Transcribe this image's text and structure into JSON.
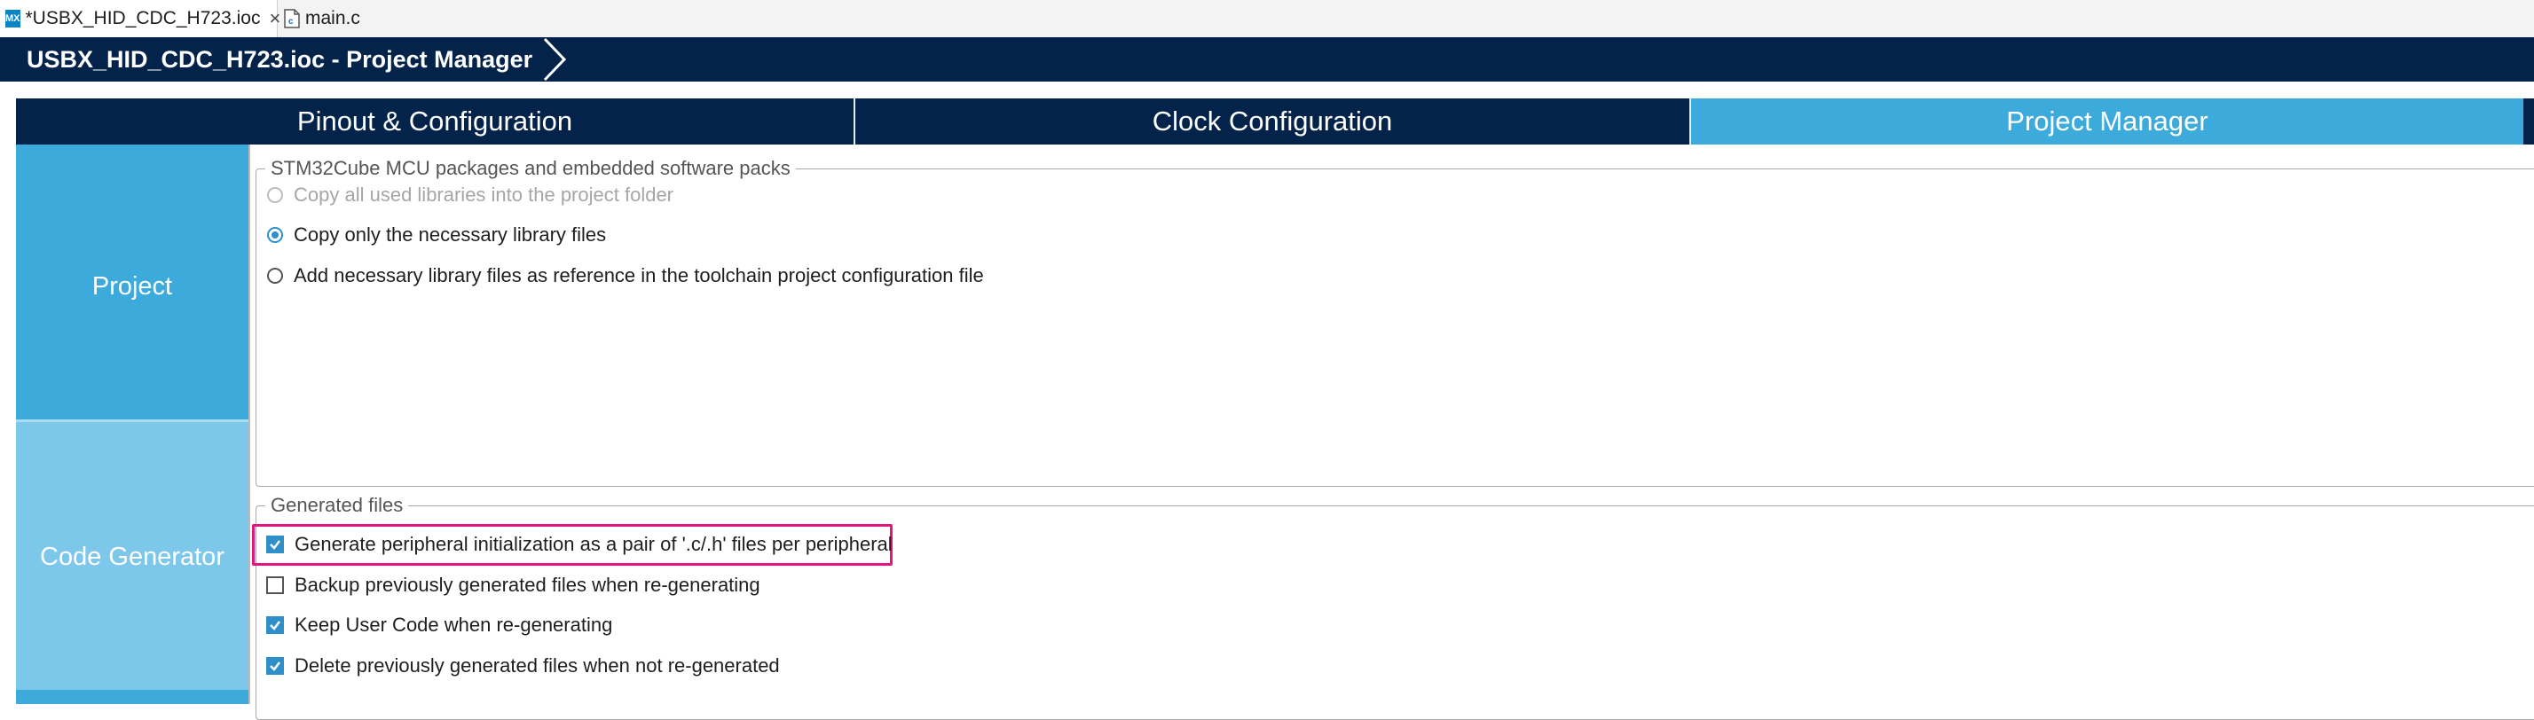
{
  "editor_tabs": [
    {
      "icon": "mx-icon",
      "icon_text": "MX",
      "label": "*USBX_HID_CDC_H723.ioc",
      "active": true
    },
    {
      "icon": "c-file-icon",
      "label": "main.c",
      "active": false
    }
  ],
  "title_bar": {
    "title": "USBX_HID_CDC_H723.ioc - Project Manager"
  },
  "main_tabs": [
    {
      "label": "Pinout & Configuration",
      "active": false
    },
    {
      "label": "Clock Configuration",
      "active": false
    },
    {
      "label": "Project Manager",
      "active": true
    }
  ],
  "side_nav": {
    "items": [
      {
        "label": "Project"
      },
      {
        "label": "Code Generator"
      }
    ]
  },
  "packages_group": {
    "title": "STM32Cube MCU packages and embedded software packs",
    "options": [
      {
        "label": "Copy all used libraries into the project folder",
        "state": "disabled"
      },
      {
        "label": "Copy only the necessary library files",
        "state": "checked"
      },
      {
        "label": "Add necessary library files as reference in the toolchain project configuration file",
        "state": "unchecked"
      }
    ]
  },
  "generated_group": {
    "title": "Generated files",
    "options": [
      {
        "label": "Generate peripheral initialization as a pair of '.c/.h' files per peripheral",
        "checked": true,
        "highlighted": true
      },
      {
        "label": "Backup previously generated files when re-generating",
        "checked": false
      },
      {
        "label": "Keep User Code when re-generating",
        "checked": true
      },
      {
        "label": "Delete previously generated files when not re-generated",
        "checked": true
      }
    ]
  },
  "colors": {
    "navy": "#03234b",
    "accent_blue": "#3caadb",
    "light_blue": "#7cc7ea",
    "highlight": "#e3157f"
  }
}
